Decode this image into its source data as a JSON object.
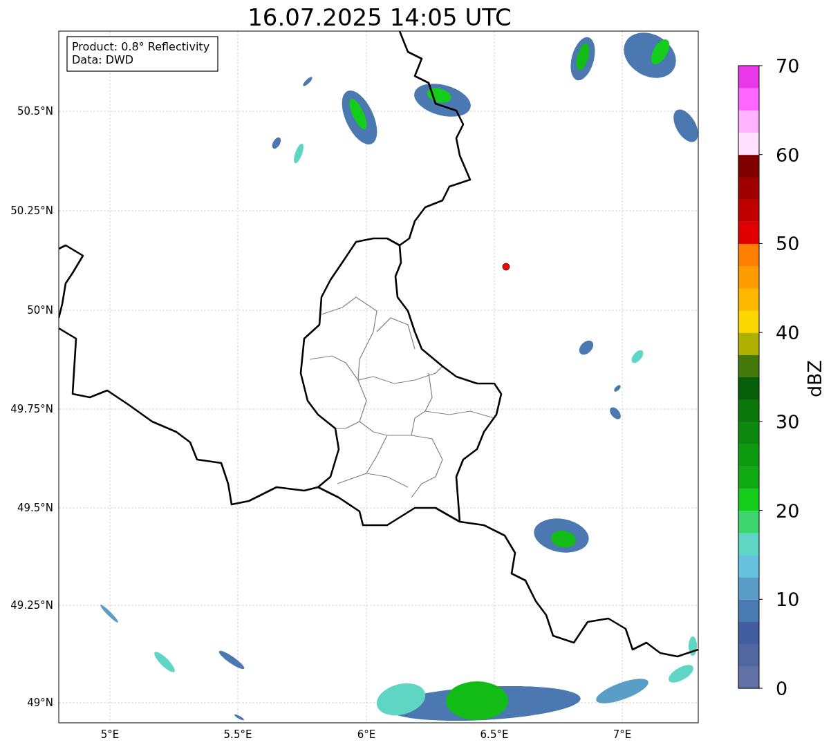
{
  "title": "16.07.2025 14:05 UTC",
  "info_box": {
    "lines": [
      "Product: 0.8° Reflectivity",
      "Data: DWD"
    ]
  },
  "x_ticks": [
    "5°E",
    "5.5°E",
    "6°E",
    "6.5°E",
    "7°E"
  ],
  "y_ticks": [
    "50.5°N",
    "50.25°N",
    "50°N",
    "49.75°N",
    "49.5°N",
    "49.25°N",
    "49°N"
  ],
  "colorbar": {
    "label": "dBZ",
    "ticks": [
      "70",
      "60",
      "50",
      "40",
      "30",
      "20",
      "10",
      "0"
    ],
    "segments": [
      {
        "color": "#6372a6"
      },
      {
        "color": "#5266a0"
      },
      {
        "color": "#435ea0"
      },
      {
        "color": "#4a7ab2"
      },
      {
        "color": "#5a9ec8"
      },
      {
        "color": "#66c2de"
      },
      {
        "color": "#5fd6c4"
      },
      {
        "color": "#3dd66e"
      },
      {
        "color": "#14cc1a"
      },
      {
        "color": "#10aa12"
      },
      {
        "color": "#0e9a10"
      },
      {
        "color": "#0c880e"
      },
      {
        "color": "#0a760c"
      },
      {
        "color": "#075e0a"
      },
      {
        "color": "#457a0a"
      },
      {
        "color": "#b0b000"
      },
      {
        "color": "#ffd700"
      },
      {
        "color": "#ffb800"
      },
      {
        "color": "#ff9c00"
      },
      {
        "color": "#ff8000"
      },
      {
        "color": "#e00000"
      },
      {
        "color": "#c00000"
      },
      {
        "color": "#a00000"
      },
      {
        "color": "#800000"
      },
      {
        "color": "#ffe0ff"
      },
      {
        "color": "#ffb3ff"
      },
      {
        "color": "#ff66ff"
      },
      {
        "color": "#e838e8"
      }
    ]
  }
}
